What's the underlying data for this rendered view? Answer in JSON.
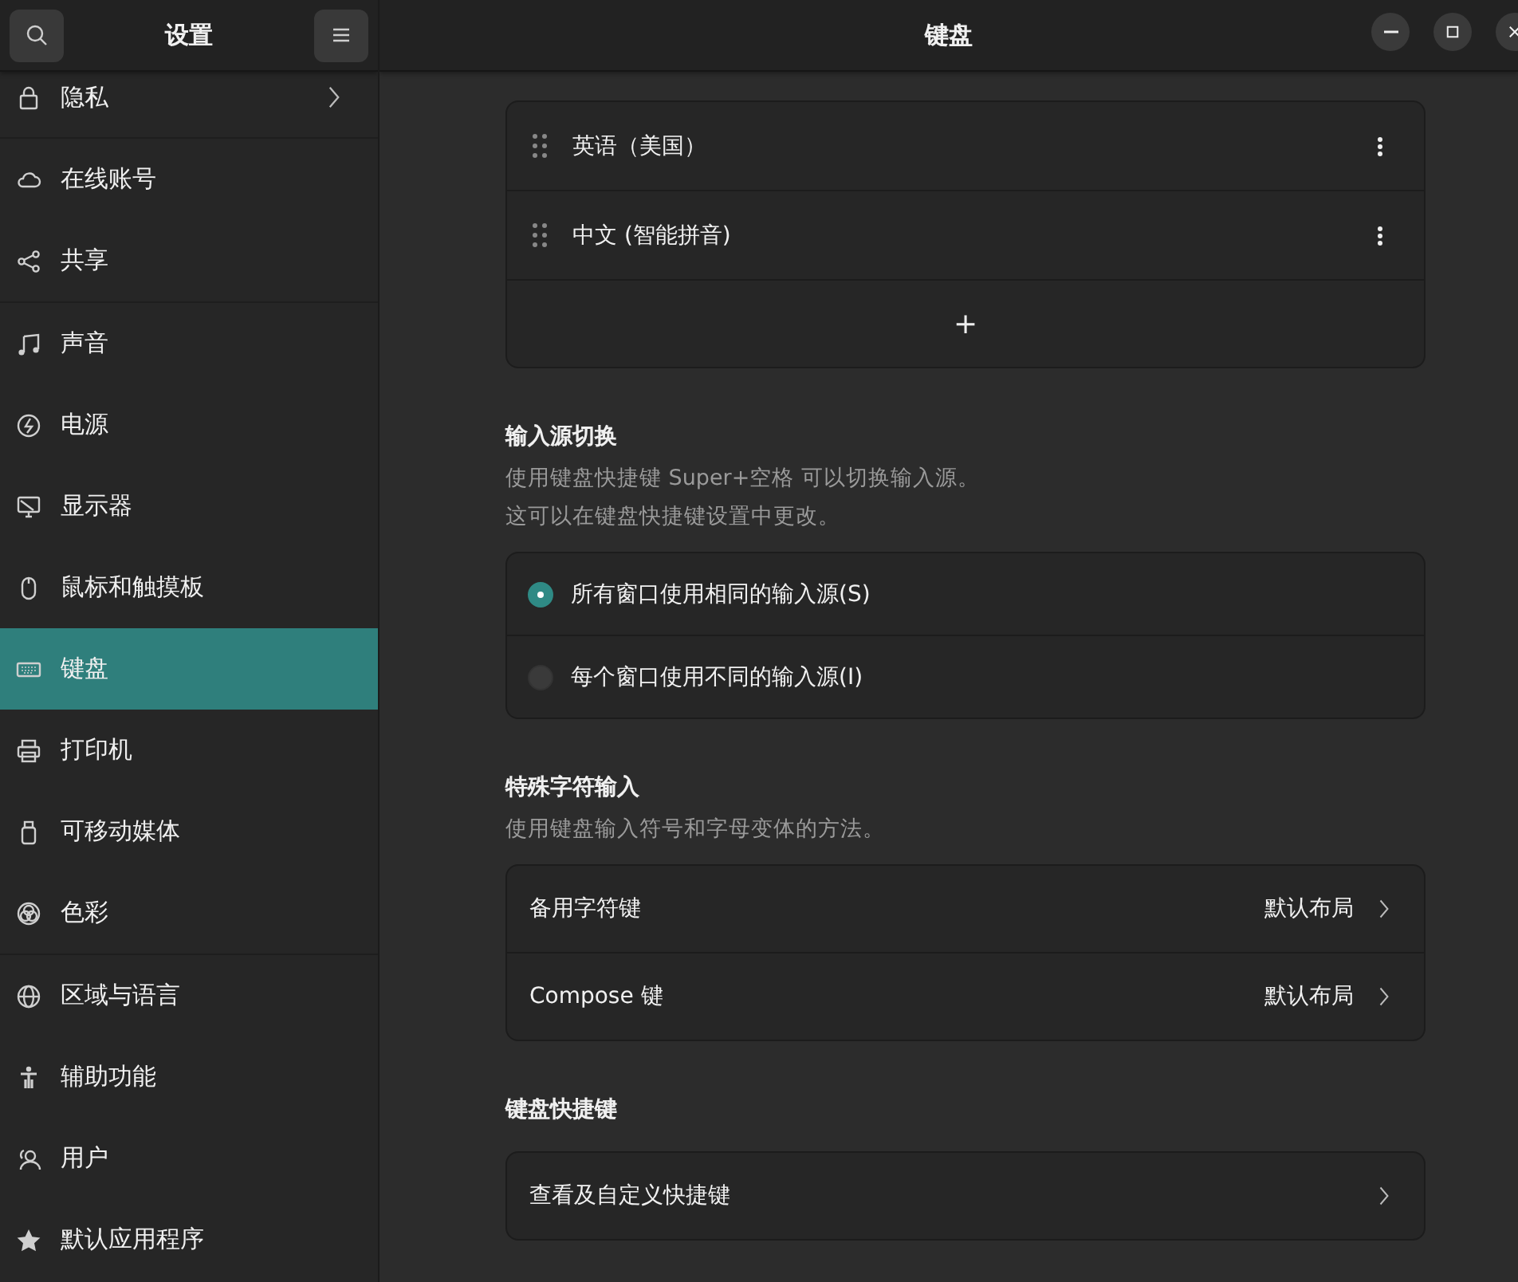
{
  "sidebar": {
    "title": "设置",
    "groups": [
      {
        "items": [
          {
            "label": "隐私",
            "selected": false,
            "chevron": true
          }
        ]
      },
      {
        "items": [
          {
            "label": "在线账号",
            "selected": false,
            "chevron": false
          },
          {
            "label": "共享",
            "selected": false,
            "chevron": false
          }
        ]
      },
      {
        "items": [
          {
            "label": "声音",
            "selected": false,
            "chevron": false
          },
          {
            "label": "电源",
            "selected": false,
            "chevron": false
          },
          {
            "label": "显示器",
            "selected": false,
            "chevron": false
          },
          {
            "label": "鼠标和触摸板",
            "selected": false,
            "chevron": false
          },
          {
            "label": "键盘",
            "selected": true,
            "chevron": false
          },
          {
            "label": "打印机",
            "selected": false,
            "chevron": false
          },
          {
            "label": "可移动媒体",
            "selected": false,
            "chevron": false
          },
          {
            "label": "色彩",
            "selected": false,
            "chevron": false
          }
        ]
      },
      {
        "items": [
          {
            "label": "区域与语言",
            "selected": false,
            "chevron": false
          },
          {
            "label": "辅助功能",
            "selected": false,
            "chevron": false
          },
          {
            "label": "用户",
            "selected": false,
            "chevron": false
          },
          {
            "label": "默认应用程序",
            "selected": false,
            "chevron": false
          }
        ]
      }
    ]
  },
  "window": {
    "title": "键盘"
  },
  "input_sources": {
    "items": [
      {
        "label": "英语（美国）"
      },
      {
        "label": "中文 (智能拼音)"
      }
    ],
    "add": "+"
  },
  "switching": {
    "title": "输入源切换",
    "description": [
      "使用键盘快捷键 Super+空格 可以切换输入源。",
      "这可以在键盘快捷键设置中更改。"
    ],
    "options": [
      {
        "label": "所有窗口使用相同的输入源(S)",
        "selected": true
      },
      {
        "label": "每个窗口使用不同的输入源(I)",
        "selected": false
      }
    ]
  },
  "special": {
    "title": "特殊字符输入",
    "description": "使用键盘输入符号和字母变体的方法。",
    "rows": [
      {
        "label": "备用字符键",
        "value": "默认布局"
      },
      {
        "label": "Compose 键",
        "value": "默认布局"
      }
    ]
  },
  "shortcuts": {
    "title": "键盘快捷键",
    "rows": [
      {
        "label": "查看及自定义快捷键"
      }
    ]
  }
}
